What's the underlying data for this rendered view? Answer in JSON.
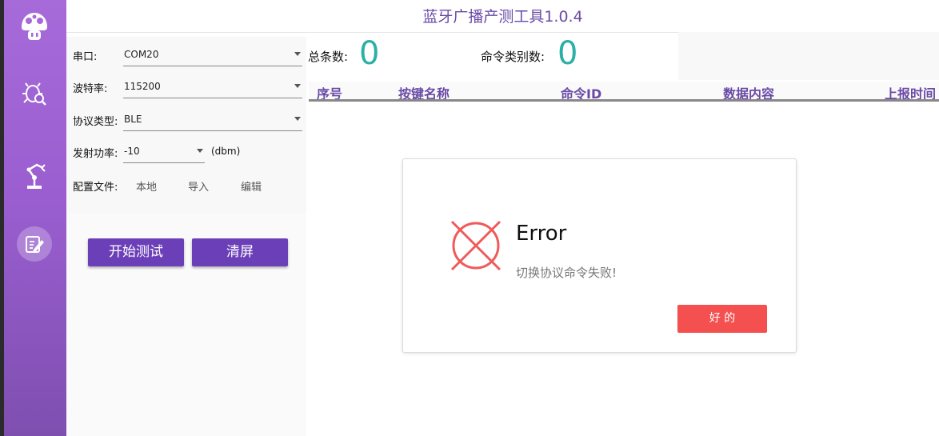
{
  "app": {
    "title": "蓝牙广播产测工具1.0.4"
  },
  "nav": {
    "items": [
      {
        "icon": "mushroom-icon"
      },
      {
        "icon": "bug-search-icon"
      },
      {
        "icon": "robot-arm-icon"
      },
      {
        "icon": "edit-note-icon",
        "active": true
      }
    ]
  },
  "config": {
    "port_label": "串口:",
    "port_value": "COM20",
    "baud_label": "波特率:",
    "baud_value": "115200",
    "protocol_label": "协议类型:",
    "protocol_value": "BLE",
    "power_label": "发射功率:",
    "power_value": "-10",
    "power_unit": "(dbm)",
    "file_label": "配置文件:",
    "file_local": "本地",
    "file_import": "导入",
    "file_edit": "编辑"
  },
  "actions": {
    "start_label": "开始测试",
    "clear_label": "清屏"
  },
  "stats": {
    "total_label": "总条数:",
    "total_value": "0",
    "types_label": "命令类别数:",
    "types_value": "0"
  },
  "table": {
    "columns": [
      "序号",
      "按键名称",
      "命令ID",
      "数据内容",
      "上报时间"
    ]
  },
  "dialog": {
    "title": "Error",
    "message": "切换协议命令失败!",
    "ok_label": "好 的"
  },
  "colors": {
    "accent": "#6b3fb8",
    "title_text": "#6a4aa6",
    "stat_value": "#2ab0a6",
    "error": "#f45050"
  }
}
